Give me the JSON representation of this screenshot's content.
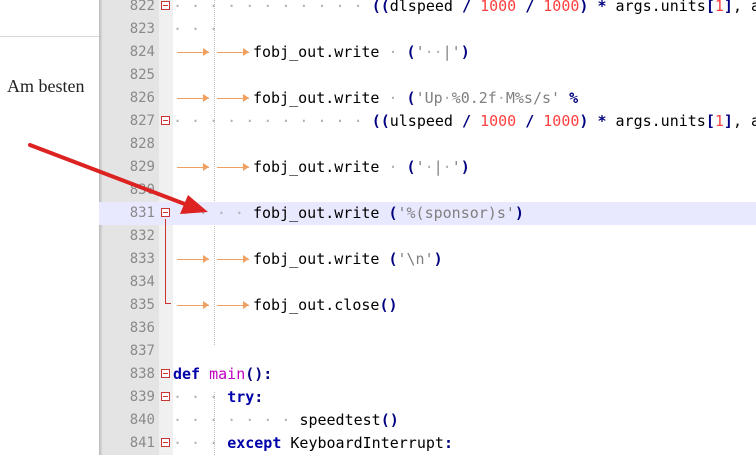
{
  "web_page": {
    "partial_text": "Am besten"
  },
  "editor": {
    "lines": [
      {
        "num": "822",
        "text": "((dlspeed / 1000 / 1000) * args.units[1], args.u"
      },
      {
        "num": "823",
        "text": ""
      },
      {
        "num": "824",
        "text": "fobj_out.write ('  |')"
      },
      {
        "num": "825",
        "text": ""
      },
      {
        "num": "826",
        "text": "fobj_out.write ('Up %0.2f M%s/s' %"
      },
      {
        "num": "827",
        "text": "((ulspeed / 1000 / 1000) * args.units[1], args.u"
      },
      {
        "num": "828",
        "text": ""
      },
      {
        "num": "829",
        "text": "fobj_out.write ('  | ')"
      },
      {
        "num": "830",
        "text": ""
      },
      {
        "num": "831",
        "text": "fobj_out.write ('%(sponsor)s')"
      },
      {
        "num": "832",
        "text": ""
      },
      {
        "num": "833",
        "text": "fobj_out.write ('\\n')"
      },
      {
        "num": "834",
        "text": ""
      },
      {
        "num": "835",
        "text": "fobj_out.close()"
      },
      {
        "num": "836",
        "text": ""
      },
      {
        "num": "837",
        "text": ""
      },
      {
        "num": "838",
        "text": "def main():"
      },
      {
        "num": "839",
        "text": "try:"
      },
      {
        "num": "840",
        "text": "speedtest()"
      },
      {
        "num": "841",
        "text": "except KeyboardInterrupt:"
      }
    ],
    "highlighted_line": "831"
  },
  "colors": {
    "annotation_arrow": "#dd2222",
    "current_line": "#e8e8ff",
    "fold_marker": "#cc3333",
    "keyword": "#0000aa",
    "function_name": "#c000c0",
    "number": "#ff4040",
    "tab_arrow": "#f0a060"
  }
}
